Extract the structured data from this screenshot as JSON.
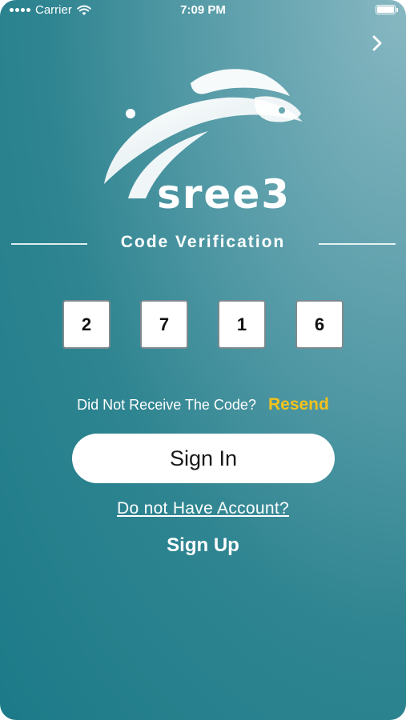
{
  "status_bar": {
    "carrier": "Carrier",
    "time": "7:09 PM",
    "wifi_icon": "wifi-icon",
    "battery_icon": "battery-icon",
    "battery_level": 1.0
  },
  "header": {
    "next_icon": "chevron-right-icon"
  },
  "logo": {
    "wordmark": "sree3",
    "icon": "rabbit-logo-icon"
  },
  "verification": {
    "title": "Code Verification",
    "digits": [
      "2",
      "7",
      "1",
      "6"
    ],
    "resend_prompt": "Did Not Receive The Code?",
    "resend_label": "Resend"
  },
  "actions": {
    "sign_in_label": "Sign In",
    "no_account_label": "Do not Have Account?",
    "sign_up_label": "Sign Up"
  },
  "colors": {
    "accent_resend": "#f2c21d",
    "background_top": "#88b8c2",
    "background_bottom": "#1c7a88",
    "button_bg": "#ffffff"
  }
}
